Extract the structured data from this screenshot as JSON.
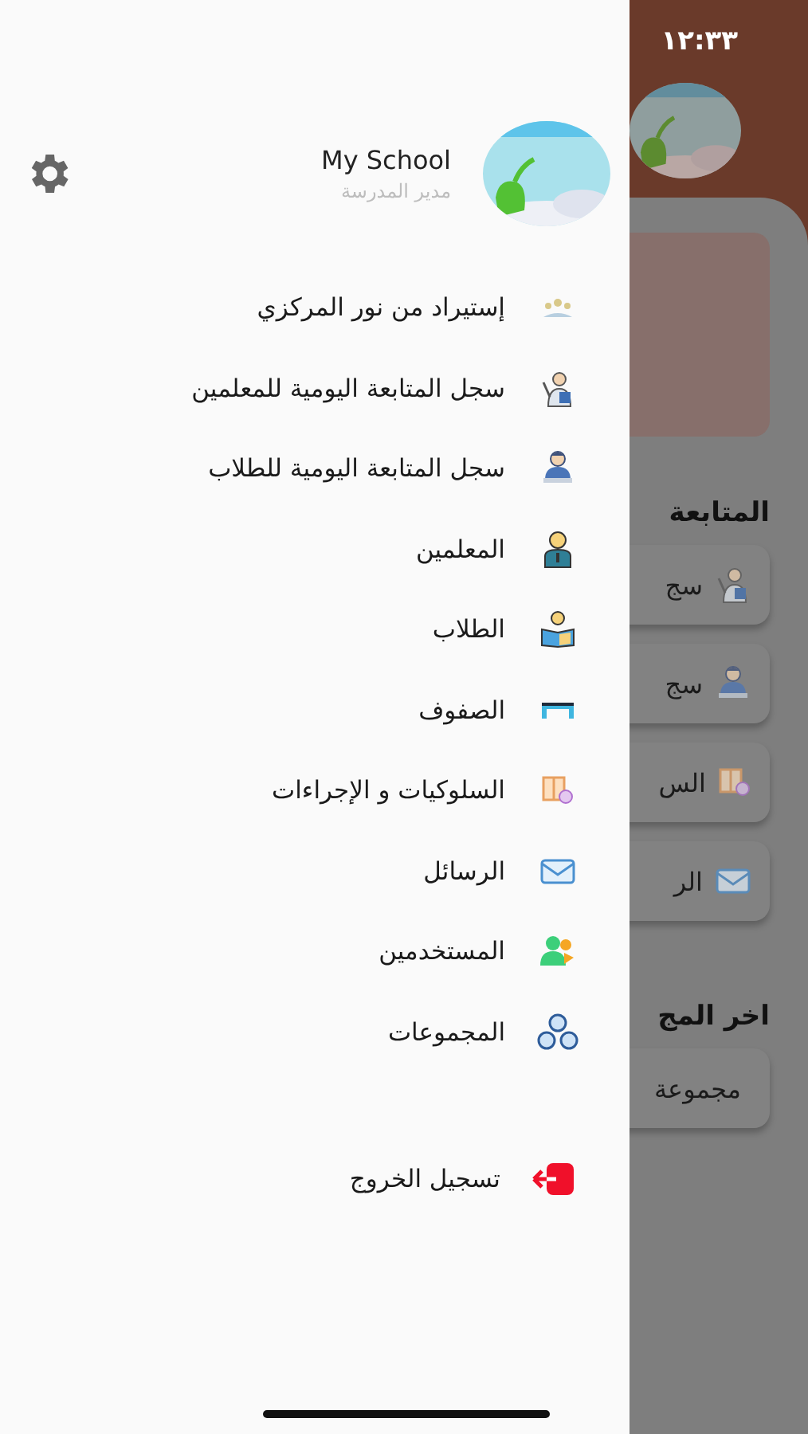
{
  "status_bar": {
    "time": "١٢:٣٣"
  },
  "background": {
    "section_title": "المتابعة",
    "cards": [
      {
        "kind": "teacher-log",
        "label": "سج"
      },
      {
        "kind": "student-log",
        "label": "سج"
      },
      {
        "kind": "behaviors",
        "label": "الس"
      },
      {
        "kind": "messages",
        "label": "الر"
      }
    ],
    "groups_title": "اخر المج",
    "group_card": "مجموعة"
  },
  "drawer": {
    "profile": {
      "name": "My School",
      "role": "مدير المدرسة"
    },
    "items": [
      {
        "kind": "import",
        "label": "إستيراد من نور المركزي"
      },
      {
        "kind": "teacher-log",
        "label": "سجل المتابعة اليومية للمعلمين"
      },
      {
        "kind": "student-log",
        "label": "سجل المتابعة اليومية للطلاب"
      },
      {
        "kind": "teachers",
        "label": "المعلمين"
      },
      {
        "kind": "students",
        "label": "الطلاب"
      },
      {
        "kind": "classes",
        "label": "الصفوف"
      },
      {
        "kind": "behaviors",
        "label": "السلوكيات و الإجراءات"
      },
      {
        "kind": "messages",
        "label": "الرسائل"
      },
      {
        "kind": "users",
        "label": "المستخدمين"
      },
      {
        "kind": "groups",
        "label": "المجموعات"
      }
    ],
    "logout": "تسجيل الخروج"
  }
}
